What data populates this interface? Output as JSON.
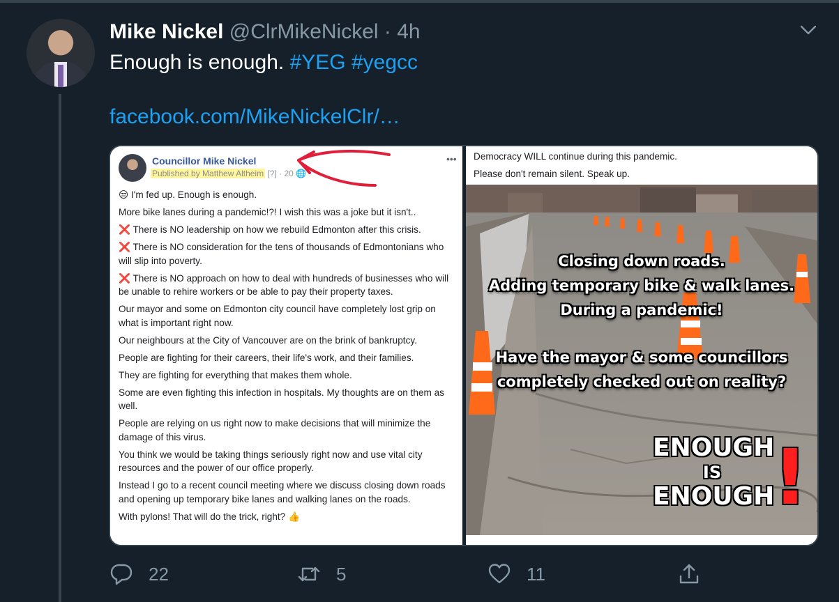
{
  "tweet": {
    "author_name": "Mike Nickel",
    "handle": "@ClrMikeNickel",
    "separator": "·",
    "time": "4h",
    "text": "Enough is enough.",
    "hashtags": [
      "#YEG",
      "#yegcc"
    ],
    "link": "facebook.com/MikeNickelClr/…"
  },
  "media": {
    "fb_post": {
      "page_name": "Councillor Mike Nickel",
      "published_by": "Published by Matthew Altheim",
      "published_meta": "[?] · 20",
      "paragraphs": [
        "😒 I'm fed up. Enough is enough.",
        "More bike lanes during a pandemic!?! I wish this was a joke but it isn't..",
        "There is NO leadership on how we rebuild Edmonton after this crisis.",
        "There is NO consideration for the tens of thousands of Edmontonians who will slip into poverty.",
        "There is NO approach on how to deal with hundreds of businesses who will be unable to rehire workers or be able to pay their property taxes.",
        "Our mayor and some on Edmonton city council have completely lost grip on what is important right now.",
        "Our neighbours at the City of Vancouver are on the brink of bankruptcy.",
        "People are fighting for their careers, their life's work, and their families.",
        "They are fighting for everything that makes them whole.",
        "Some are even fighting this infection in hospitals. My thoughts are on them as well.",
        "People are relying on us right now to make decisions that will minimize the damage of this virus.",
        "You think we would be taking things seriously right now and use vital city resources and the power of our office properly.",
        "Instead I go to a recent council meeting where we discuss closing down roads and opening up temporary bike lanes and walking lanes on the roads.",
        "With pylons! That will do the trick, right? 👍"
      ],
      "x_mark": "❌"
    },
    "right_panel": {
      "line1": "Democracy WILL continue during this pandemic.",
      "line2": "Please don't remain silent. Speak up.",
      "overlay_lines_1": [
        "Closing down roads.",
        "Adding temporary bike & walk lanes.",
        "During a pandemic!"
      ],
      "overlay_lines_2": [
        "Have the mayor & some councillors",
        "completely checked out on reality?"
      ],
      "enough_top": "ENOUGH",
      "enough_mid": "IS",
      "enough_bottom": "ENOUGH",
      "exclamation": "!"
    }
  },
  "actions": {
    "reply_count": "22",
    "retweet_count": "5",
    "like_count": "11"
  },
  "colors": {
    "background": "#15202b",
    "accent": "#1da1f2",
    "muted": "#8899a6",
    "border": "#38444d",
    "arrow": "#e0203a"
  }
}
